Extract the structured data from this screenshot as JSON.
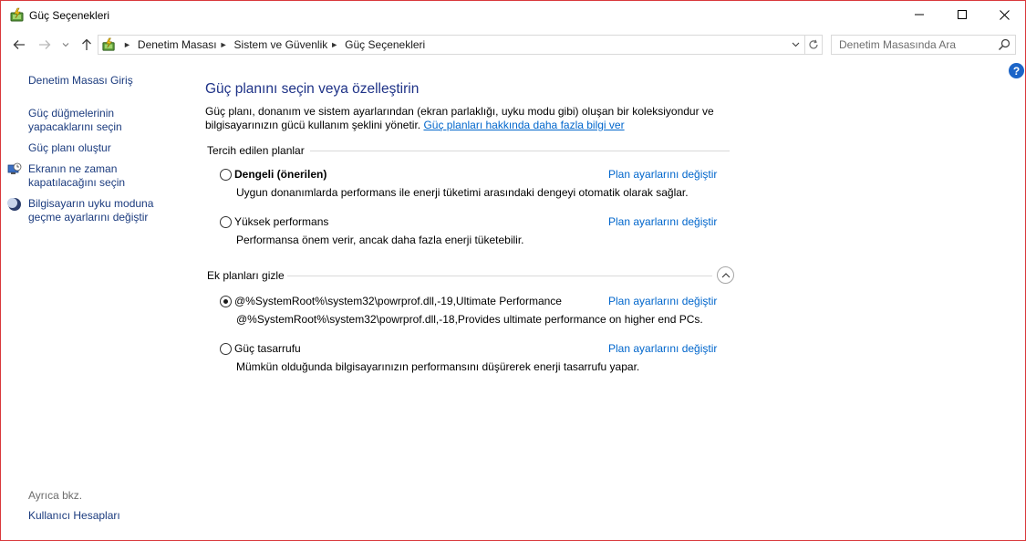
{
  "window": {
    "title": "Güç Seçenekleri",
    "icon": "power-options-icon"
  },
  "address": {
    "crumbs": [
      "Denetim Masası",
      "Sistem ve Güvenlik",
      "Güç Seçenekleri"
    ],
    "search_placeholder": "Denetim Masasında Ara"
  },
  "sidebar": {
    "home": "Denetim Masası Giriş",
    "links": [
      {
        "label": "Güç düğmelerinin yapacaklarını seçin",
        "icon": ""
      },
      {
        "label": "Güç planı oluştur",
        "icon": ""
      },
      {
        "label": "Ekranın ne zaman kapatılacağını seçin",
        "icon": "display-clock-icon"
      },
      {
        "label": "Bilgisayarın uyku moduna geçme ayarlarını değiştir",
        "icon": "sleep-moon-icon"
      }
    ],
    "see_also_label": "Ayrıca bkz.",
    "see_also_links": [
      "Kullanıcı Hesapları"
    ]
  },
  "main": {
    "title": "Güç planını seçin veya özelleştirin",
    "intro_text": "Güç planı, donanım ve sistem ayarlarından (ekran parlaklığı, uyku modu gibi) oluşan bir koleksiyondur ve bilgisayarınızın gücü kullanım şeklini yönetir.",
    "intro_link": "Güç planları hakkında daha fazla bilgi ver",
    "preferred_header": "Tercih edilen planlar",
    "hidden_header": "Ek planları gizle",
    "change_link": "Plan ayarlarını değiştir",
    "preferred_plans": [
      {
        "name": "Dengeli (önerilen)",
        "desc": "Uygun donanımlarda performans ile enerji tüketimi arasındaki dengeyi otomatik olarak sağlar.",
        "selected": false,
        "bold": true
      },
      {
        "name": "Yüksek performans",
        "desc": "Performansa önem verir, ancak daha fazla enerji tüketebilir.",
        "selected": false,
        "bold": false
      }
    ],
    "extra_plans": [
      {
        "name": "@%SystemRoot%\\system32\\powrprof.dll,-19,Ultimate Performance",
        "desc": "@%SystemRoot%\\system32\\powrprof.dll,-18,Provides ultimate performance on higher end PCs.",
        "selected": true,
        "bold": false
      },
      {
        "name": "Güç tasarrufu",
        "desc": "Mümkün olduğunda bilgisayarınızın performansını düşürerek enerji tasarrufu yapar.",
        "selected": false,
        "bold": false
      }
    ]
  },
  "colors": {
    "title_blue": "#1e3287",
    "link_blue": "#0066cc",
    "sidebar_link": "#1b3b7e",
    "window_border": "#d9393c"
  }
}
